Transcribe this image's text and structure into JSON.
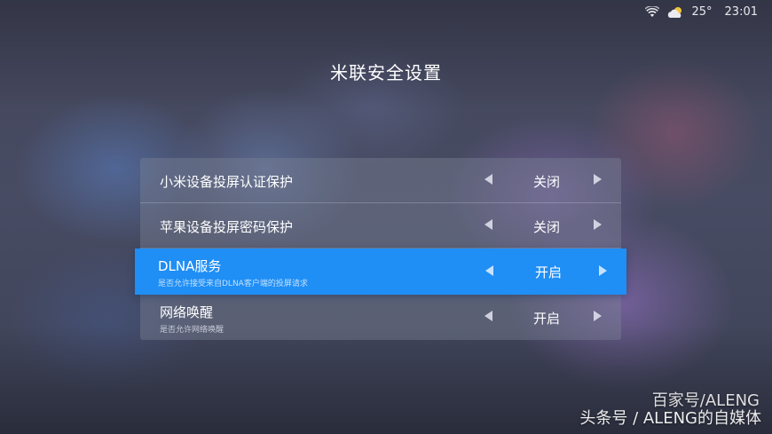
{
  "status_bar": {
    "wifi_icon": "wifi-icon",
    "weather_icon": "partly-cloudy-icon",
    "temperature": "25°",
    "time": "23:01"
  },
  "page_title": "米联安全设置",
  "settings": [
    {
      "label": "小米设备投屏认证保护",
      "subtitle": "",
      "value": "关闭",
      "selected": false
    },
    {
      "label": "苹果设备投屏密码保护",
      "subtitle": "",
      "value": "关闭",
      "selected": false
    },
    {
      "label": "DLNA服务",
      "subtitle": "是否允许接受来自DLNA客户端的投屏请求",
      "value": "开启",
      "selected": true
    },
    {
      "label": "网络唤醒",
      "subtitle": "是否允许网络唤醒",
      "value": "开启",
      "selected": false
    }
  ],
  "accent_color": "#1f8ef5",
  "watermarks": {
    "line1": "百家号/ALENG",
    "line2": "头条号 / ALENG的自媒体"
  }
}
